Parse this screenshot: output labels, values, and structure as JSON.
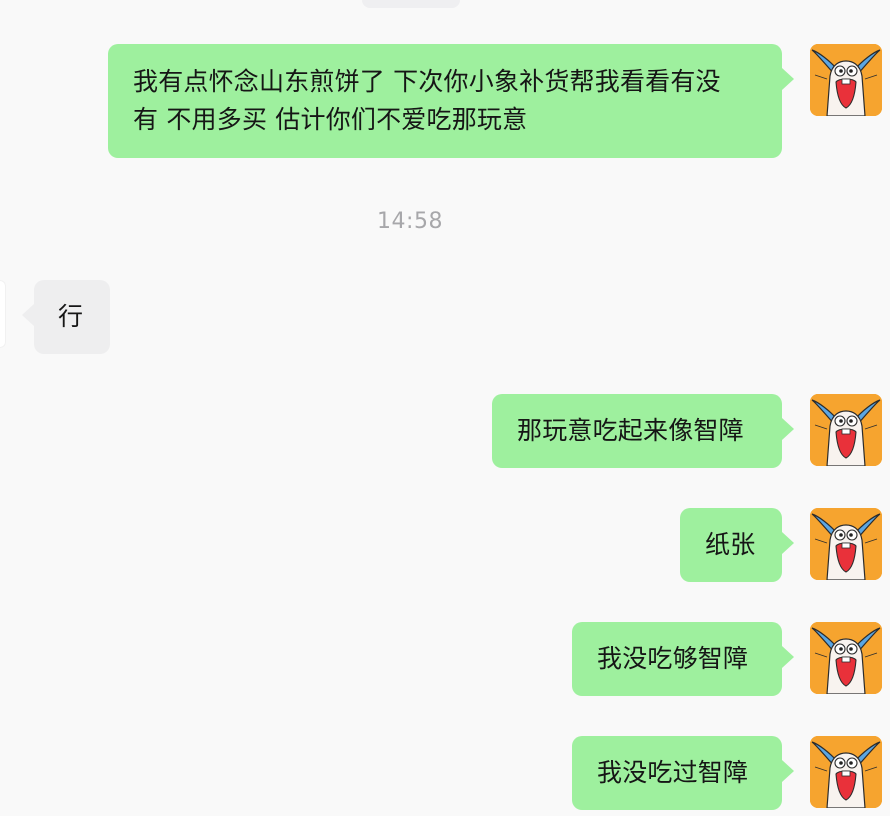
{
  "chat": {
    "messages": [
      {
        "direction": "out",
        "line1": "我有点怀念山东煎饼了 下次你小象补货帮我看看有没",
        "line2": "有  不用多买 估计你们不爱吃那玩意"
      },
      {
        "direction": "in",
        "text": "行"
      },
      {
        "direction": "out",
        "text": "那玩意吃起来像智障"
      },
      {
        "direction": "out",
        "text": "纸张"
      },
      {
        "direction": "out",
        "text": "我没吃够智障"
      },
      {
        "direction": "out",
        "text": "我没吃过智障"
      }
    ],
    "timestamp": "14:58",
    "avatar_icon": "cartoon-bunny-icon",
    "colors": {
      "outgoing_bubble": "#9EF09E",
      "incoming_bubble": "#EEEEEF",
      "background": "#F9F9F9",
      "avatar_background": "#F6A42F"
    }
  }
}
